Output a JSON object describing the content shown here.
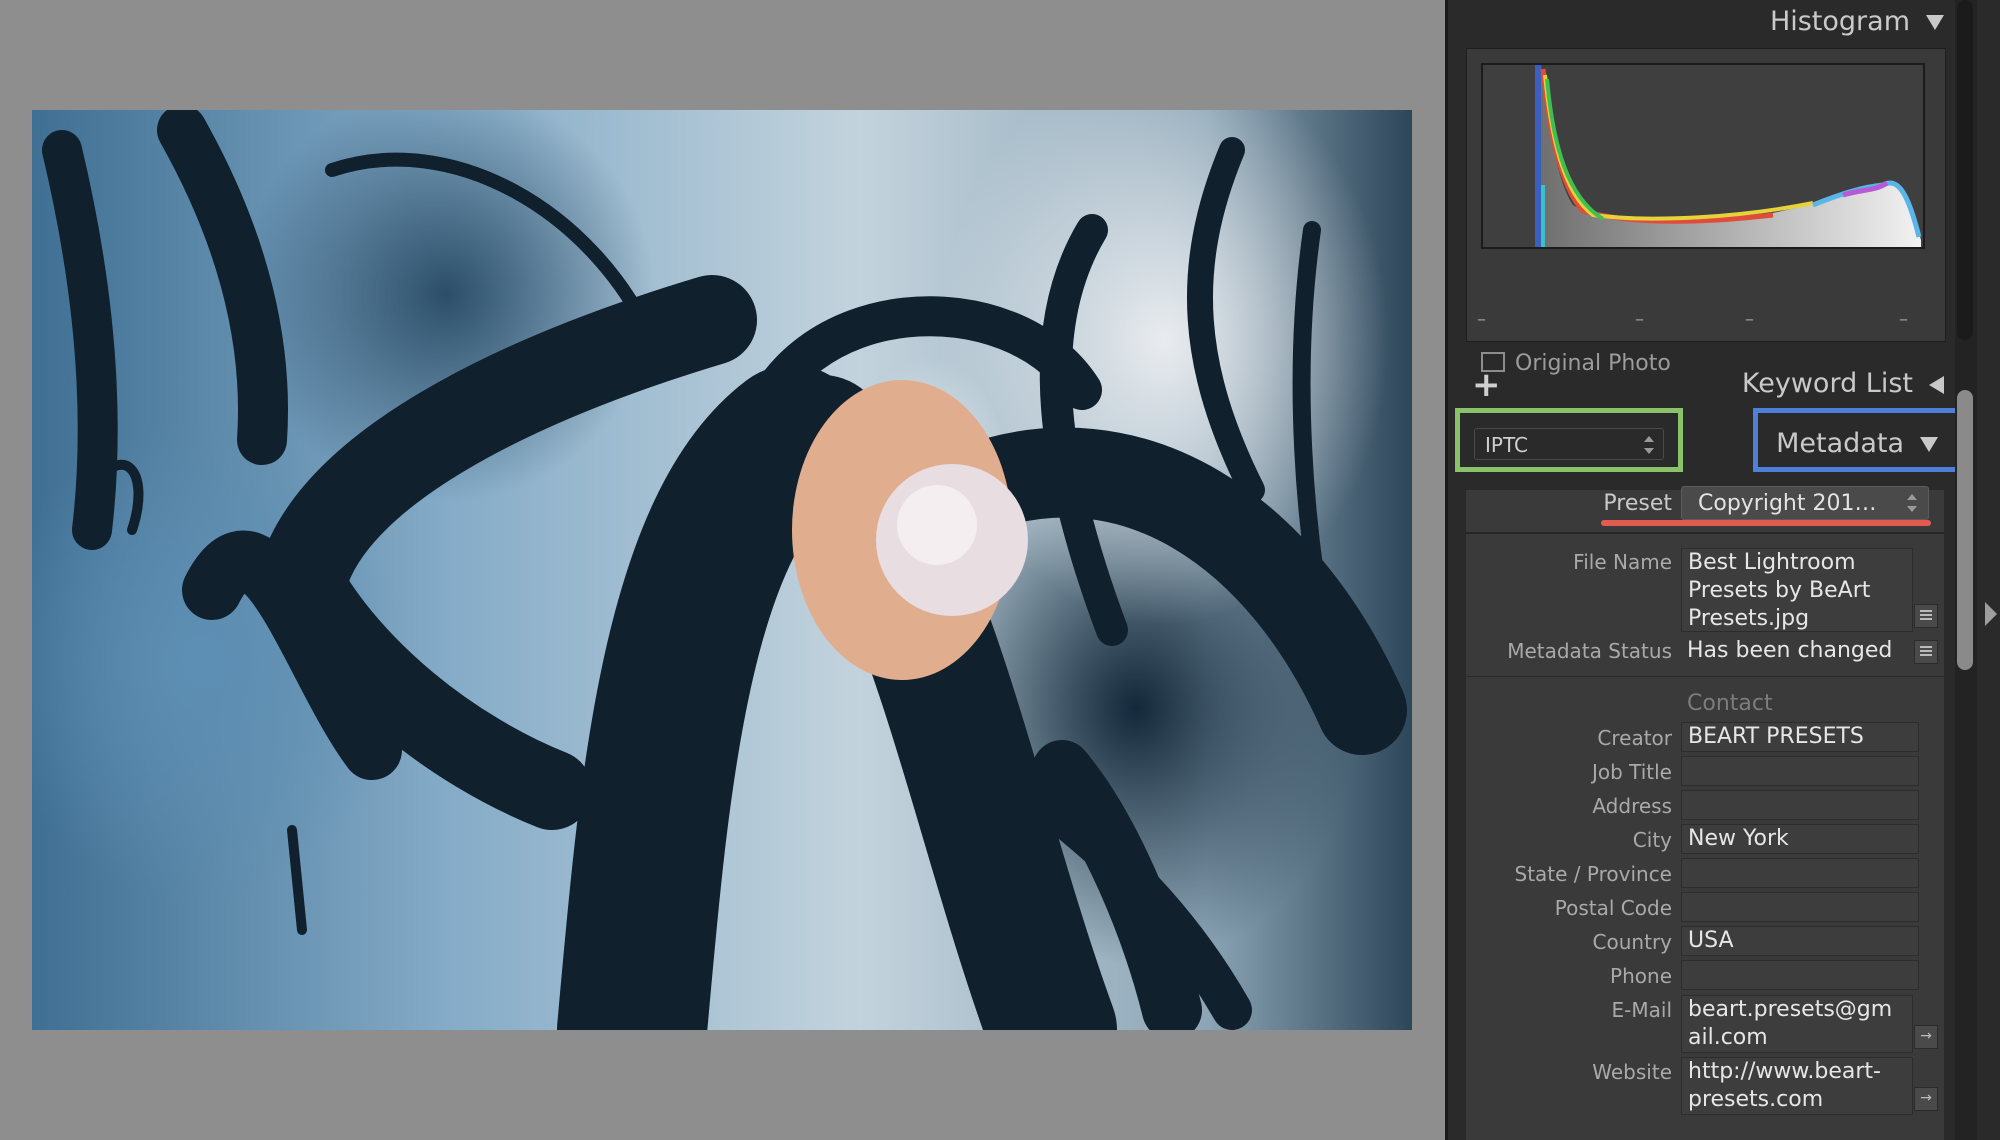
{
  "histogram": {
    "title": "Histogram",
    "ticks": [
      "–",
      "–",
      "–",
      "–"
    ],
    "original_photo_label": "Original Photo"
  },
  "keyword_list": {
    "title": "Keyword List"
  },
  "metadata": {
    "title": "Metadata",
    "set_selected": "IPTC",
    "preset_label": "Preset",
    "preset_value": "Copyright 201…",
    "fields": {
      "file_name": {
        "label": "File Name",
        "value": "Best Lightroom\nPresets by BeArt\nPresets.jpg"
      },
      "metadata_status": {
        "label": "Metadata Status",
        "value": "Has been changed"
      }
    },
    "contact_group": "Contact",
    "contact": [
      {
        "label": "Creator",
        "value": "BEART PRESETS"
      },
      {
        "label": "Job Title",
        "value": ""
      },
      {
        "label": "Address",
        "value": ""
      },
      {
        "label": "City",
        "value": "New York"
      },
      {
        "label": "State / Province",
        "value": ""
      },
      {
        "label": "Postal Code",
        "value": ""
      },
      {
        "label": "Country",
        "value": "USA"
      },
      {
        "label": "Phone",
        "value": ""
      }
    ],
    "email": {
      "label": "E-Mail",
      "value": "beart.presets@gm\nail.com"
    },
    "website": {
      "label": "Website",
      "value": "http://www.beart-\npresets.com"
    }
  },
  "colors": {
    "highlight_green": "#8ac26a",
    "highlight_blue": "#4f7fd9",
    "underline_red": "#e35b4f",
    "panel_bg": "#2a2a2a"
  }
}
